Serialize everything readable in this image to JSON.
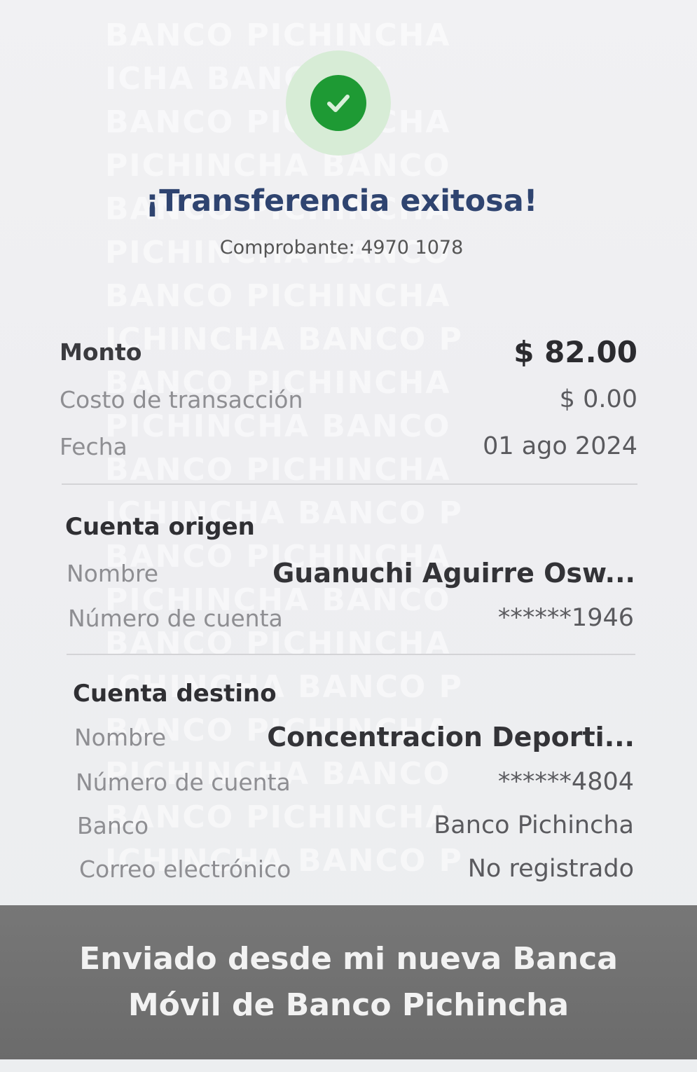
{
  "watermark": {
    "lines": [
      "BANCO PICHINCHA",
      "ICHA  BANCO PI",
      "BANCO PICHINCHA",
      "PICHINCHA  BANCO",
      "BANCO PICHINCHA",
      "PICHINCHA  BANCO",
      "BANCO PICHINCHA",
      "ICHINCHA  BANCO P",
      "BANCO PICHINCHA",
      "PICHINCHA  BANCO",
      "BANCO PICHINCHA",
      "ICHINCHA  BANCO P",
      "BANCO PICHINCHA",
      "PICHINCHA  BANCO",
      "BANCO PICHINCHA",
      "ICHINCHA  BANCO P",
      "BANCO PICHINCHA",
      "PICHINCHA  BANCO",
      "BANCO PICHINCHA",
      "ICHINCHA  BANCO P"
    ]
  },
  "status": {
    "icon": "check-icon",
    "title": "¡Transferencia exitosa!",
    "receipt": "Comprobante: 4970 1078",
    "success_color": "#1e9a34",
    "title_color": "#2f4470"
  },
  "summary": {
    "amount_label": "Monto",
    "amount_value": "$ 82.00",
    "fee_label": "Costo de transacción",
    "fee_value": "$ 0.00",
    "date_label": "Fecha",
    "date_value": "01 ago 2024"
  },
  "origin": {
    "section_title": "Cuenta origen",
    "name_label": "Nombre",
    "name_value": "Guanuchi  Aguirre Osw...",
    "account_label": "Número de cuenta",
    "account_value": "******1946"
  },
  "destination": {
    "section_title": "Cuenta destino",
    "name_label": "Nombre",
    "name_value": "Concentracion Deporti...",
    "account_label": "Número de cuenta",
    "account_value": "******4804",
    "bank_label": "Banco",
    "bank_value": "Banco Pichincha",
    "email_label": "Correo electrónico",
    "email_value": "No registrado"
  },
  "footer": {
    "line1": "Enviado desde mi nueva Banca",
    "line2": "Móvil de Banco Pichincha"
  }
}
